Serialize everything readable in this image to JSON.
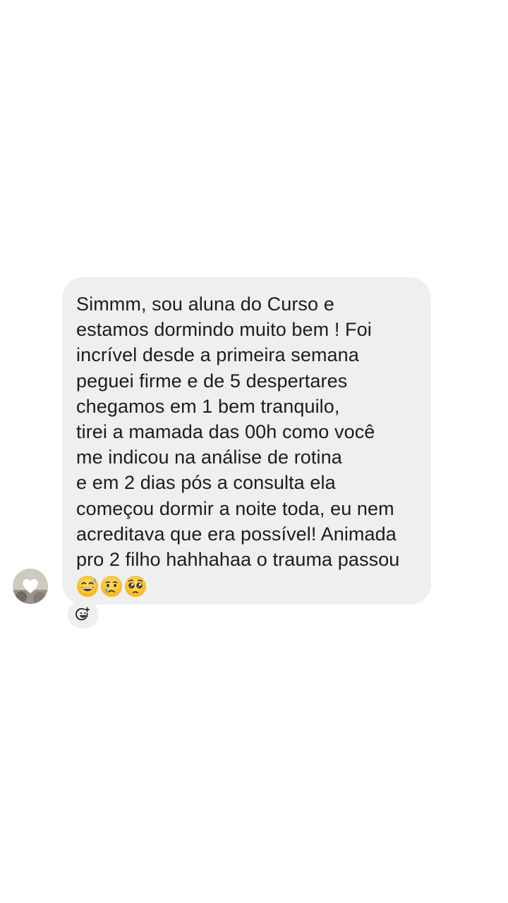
{
  "message": {
    "lines": [
      "Simmm, sou aluna do Curso e",
      "estamos dormindo muito bem ! Foi",
      "incrível desde a primeira semana",
      "peguei firme e de 5 despertares",
      "chegamos em 1 bem tranquilo,",
      "tirei a mamada das 00h como você",
      "me indicou na análise de rotina",
      "e em 2 dias pós a consulta ela",
      "começou dormir a noite toda, eu nem",
      "acreditava que era possível! Animada",
      "pro 2 filho hahhahaa o trauma passou"
    ],
    "emojis": [
      "grinning-face-with-sweat-icon",
      "crying-face-icon",
      "pleading-face-icon"
    ]
  },
  "sender": {
    "avatar_icon": "profile-photo-avatar"
  },
  "reaction_button": {
    "icon": "add-reaction-icon"
  },
  "colors": {
    "background": "#ffffff",
    "bubble": "#efefef",
    "text": "#1c1c1c"
  }
}
